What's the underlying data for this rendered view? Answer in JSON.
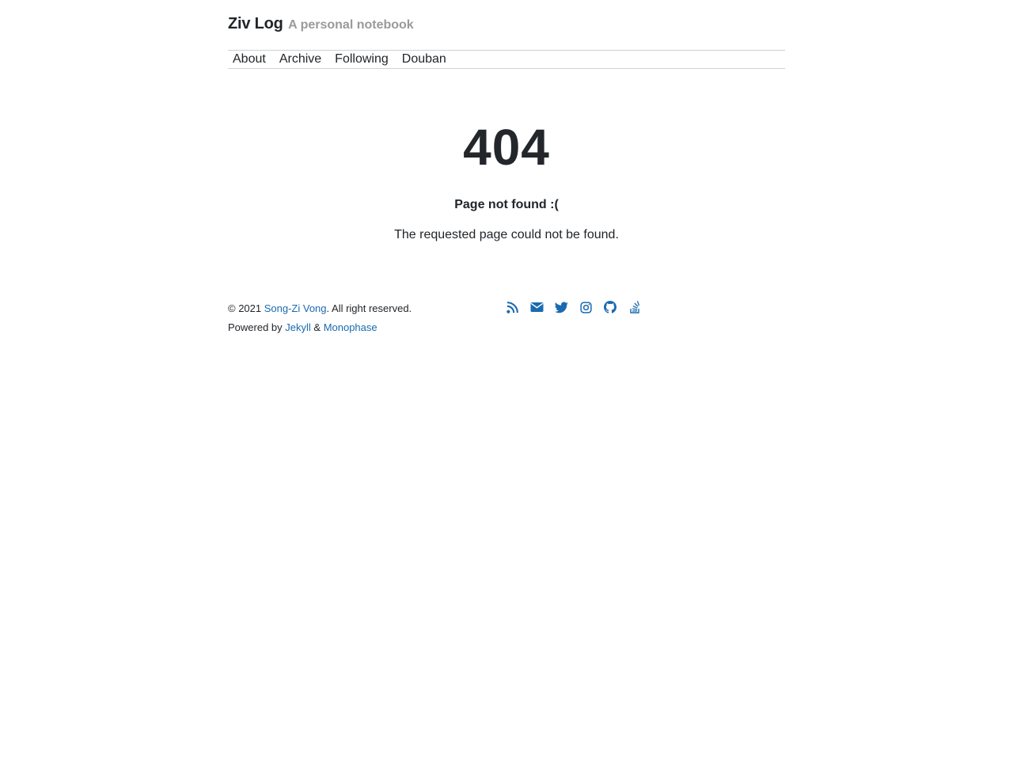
{
  "header": {
    "title": "Ziv Log",
    "tagline": "A personal notebook"
  },
  "nav": {
    "items": [
      {
        "label": "About"
      },
      {
        "label": "Archive"
      },
      {
        "label": "Following"
      },
      {
        "label": "Douban"
      }
    ]
  },
  "error": {
    "code": "404",
    "title": "Page not found :(",
    "message": "The requested page could not be found."
  },
  "footer": {
    "copyright_prefix": "© 2021 ",
    "author": "Song-Zi Vong",
    "copyright_suffix": ". All right reserved.",
    "powered_prefix": "Powered by ",
    "jekyll": "Jekyll",
    "amp": " & ",
    "theme": "Monophase",
    "link_color": "#1a6ab1"
  },
  "social": {
    "icons": [
      "rss-icon",
      "envelope-icon",
      "twitter-icon",
      "instagram-icon",
      "github-icon",
      "stack-overflow-icon"
    ]
  }
}
